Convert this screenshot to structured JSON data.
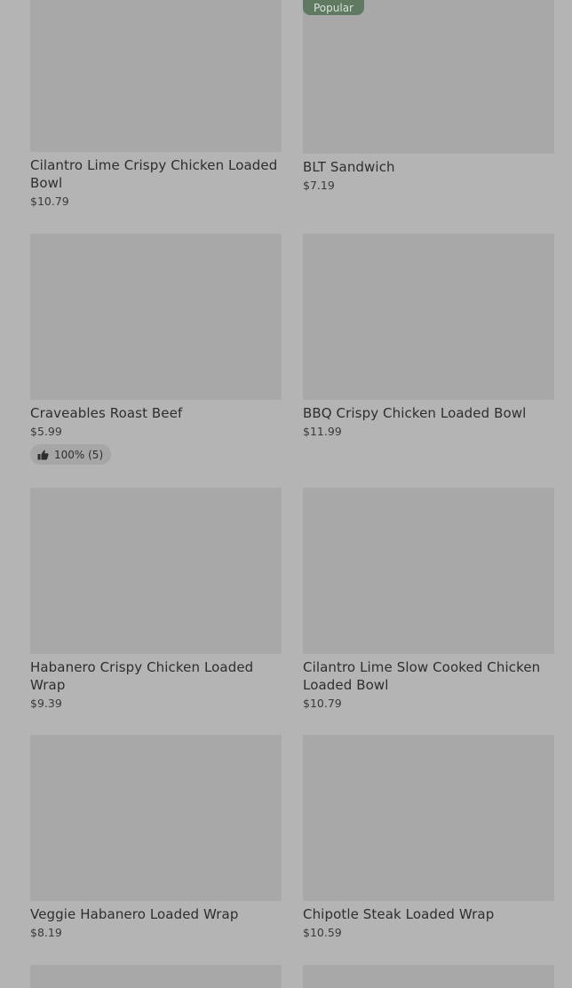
{
  "badges": {
    "popular": "Popular"
  },
  "items": [
    {
      "name": "Cilantro Lime Crispy Chicken Loaded Bowl",
      "price": "$10.79"
    },
    {
      "name": "BLT Sandwich",
      "price": "$7.19"
    },
    {
      "name": "Craveables Roast Beef",
      "price": "$5.99",
      "rating": "100% (5)"
    },
    {
      "name": "BBQ Crispy Chicken Loaded Bowl",
      "price": "$11.99"
    },
    {
      "name": "Habanero Crispy Chicken Loaded Wrap",
      "price": "$9.39"
    },
    {
      "name": "Cilantro Lime Slow Cooked Chicken Loaded Bowl",
      "price": "$10.79"
    },
    {
      "name": "Veggie Habanero Loaded Wrap",
      "price": "$8.19"
    },
    {
      "name": "Chipotle Steak Loaded Wrap",
      "price": "$10.59"
    }
  ],
  "icons": {
    "thumbs_up": "thumbs-up-icon"
  }
}
